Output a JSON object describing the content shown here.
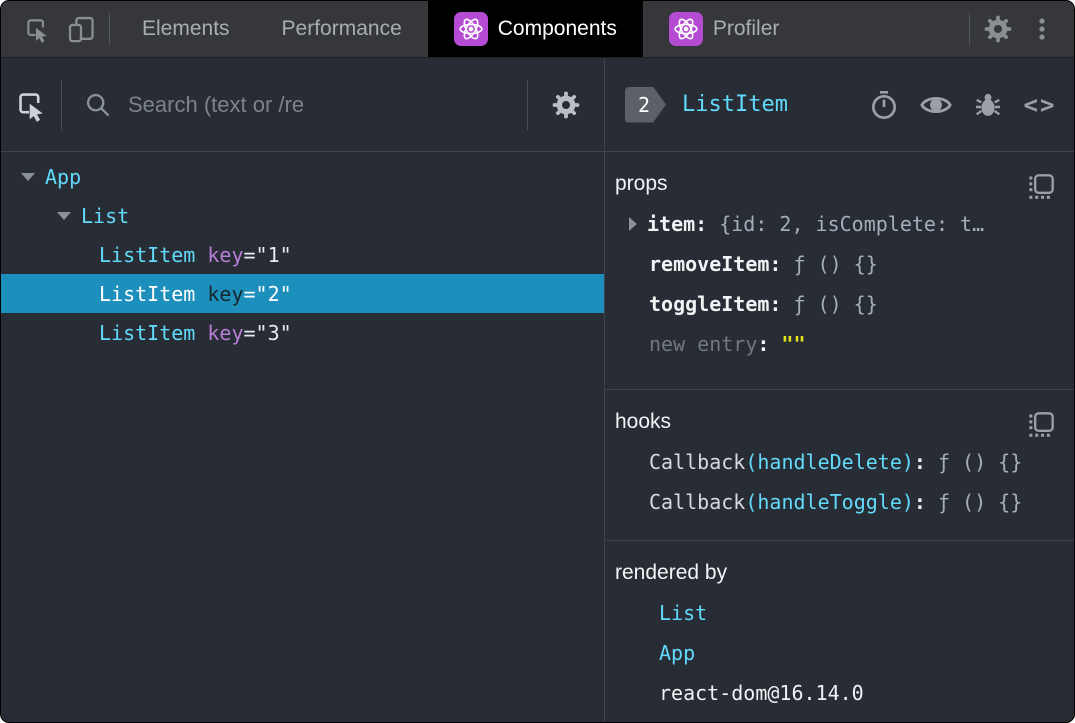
{
  "topbar": {
    "tabs": [
      {
        "label": "Elements",
        "active": false,
        "has_react_icon": false
      },
      {
        "label": "Performance",
        "active": false,
        "has_react_icon": false
      },
      {
        "label": "Components",
        "active": true,
        "has_react_icon": true
      },
      {
        "label": "Profiler",
        "active": false,
        "has_react_icon": true
      }
    ]
  },
  "icons": {
    "inspect-icon": "square with cursor arrow",
    "device-toolbar-icon": "phone and tablet",
    "react-logo-icon": "atom symbol on purple badge",
    "settings-gear-icon": "gear",
    "kebab-menu-icon": "three vertical dots",
    "search-icon": "magnifier",
    "stopwatch-icon": "suspense timer",
    "eye-icon": "inspect matching DOM element",
    "bug-icon": "log component data to console",
    "code-brackets-icon": "view source",
    "copy-icon": "copy to clipboard"
  },
  "left": {
    "search_placeholder": "Search (text or /re",
    "tree": [
      {
        "name": "App",
        "depth": 0,
        "expanded": true,
        "selected": false
      },
      {
        "name": "List",
        "depth": 1,
        "expanded": true,
        "selected": false
      },
      {
        "name": "ListItem",
        "depth": 2,
        "attr": "key",
        "value": "=\"1\"",
        "selected": false
      },
      {
        "name": "ListItem",
        "depth": 2,
        "attr": "key",
        "value": "=\"2\"",
        "selected": true
      },
      {
        "name": "ListItem",
        "depth": 2,
        "attr": "key",
        "value": "=\"3\"",
        "selected": false
      }
    ]
  },
  "right": {
    "header": {
      "badge": "2",
      "title": "ListItem",
      "code_glyph": "<>"
    },
    "props": {
      "title": "props",
      "rows": [
        {
          "name": "item",
          "colon": ":",
          "value": "{id: 2, isComplete: t…",
          "expandable": true
        },
        {
          "name": "removeItem",
          "colon": ":",
          "value": "ƒ () {}"
        },
        {
          "name": "toggleItem",
          "colon": ":",
          "value": "ƒ () {}"
        },
        {
          "name": "new entry",
          "colon": ":",
          "value": "\"\""
        }
      ]
    },
    "hooks": {
      "title": "hooks",
      "rows": [
        {
          "prefix": "Callback",
          "paren": "(handleDelete)",
          "colon": ":",
          "value": "ƒ () {}"
        },
        {
          "prefix": "Callback",
          "paren": "(handleToggle)",
          "colon": ":",
          "value": "ƒ () {}"
        }
      ]
    },
    "rendered_by": {
      "title": "rendered by",
      "items": [
        {
          "label": "List",
          "link": true
        },
        {
          "label": "App",
          "link": true
        },
        {
          "label": "react-dom@16.14.0",
          "link": false
        }
      ]
    }
  }
}
